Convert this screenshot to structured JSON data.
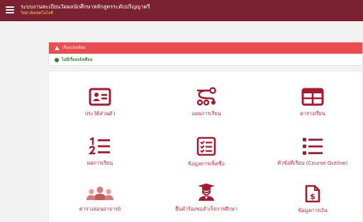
{
  "header": {
    "title": "ระบบงานทะเบียนวัดผลนักศึกษาหลักสูตรระดับปริญญาตรี",
    "subtitle": "วิทยาลัยเทคโนโลยี"
  },
  "alert": {
    "heading": "เรื่องแจ้งเตือน",
    "message": "ไม่มีเรื่องแจ้งเตือน"
  },
  "menu": {
    "profile": "ประวัติส่วนตัว",
    "study_plan": "แผนการเรียน",
    "timetable": "ตารางเรียน",
    "grades": "ผลการเรียน",
    "check_name": "ข้อมูลการเช็คชื่อ",
    "course_outline": "หัวข้อที่เรียน (Course Outline)",
    "teaching_schedule": "ตารางสอนอาจารย์",
    "graduation_request": "ยื่นคำร้องขอสำเร็จการศึกษา",
    "finance": "ข้อมูลการเงิน"
  },
  "colors": {
    "header_bg": "#7b2130",
    "alert_red": "#ea4d4f",
    "icon_red": "#a8182f",
    "label_red": "#c0263a",
    "ok_green": "#2e7d32"
  }
}
